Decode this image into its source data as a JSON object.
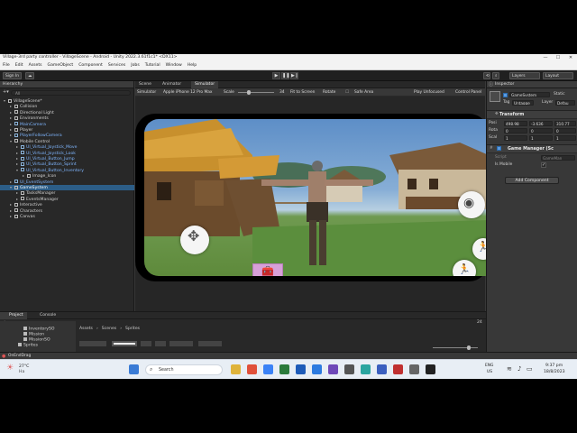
{
  "window": {
    "title": "Village-3rd party controller - VillageScene - Android - Unity 2022.3.61f1c1* <DX11>",
    "controls": [
      "—",
      "☐",
      "✕"
    ]
  },
  "menu": [
    "File",
    "Edit",
    "Assets",
    "GameObject",
    "Component",
    "Services",
    "Jobs",
    "Tutorial",
    "Window",
    "Help"
  ],
  "toolbar": {
    "signin": "Sign In",
    "layers": "Layers",
    "layout": "Layout"
  },
  "hierarchy": {
    "title": "Hierarchy",
    "search_placeholder": "All",
    "rows": [
      {
        "label": "VillageScene*",
        "depth": 0,
        "kind": "scene"
      },
      {
        "label": "Collision",
        "depth": 1
      },
      {
        "label": "Directional Light",
        "depth": 1
      },
      {
        "label": "Environments",
        "depth": 1
      },
      {
        "label": "MainCamera",
        "depth": 1,
        "blue": true
      },
      {
        "label": "Player",
        "depth": 1
      },
      {
        "label": "PlayerFollowCamera",
        "depth": 1,
        "blue": true
      },
      {
        "label": "Mobile Control",
        "depth": 1
      },
      {
        "label": "UI_Virtual_Joystick_Move",
        "depth": 2,
        "blue": true
      },
      {
        "label": "UI_Virtual_Joystick_Look",
        "depth": 2,
        "blue": true
      },
      {
        "label": "UI_Virtual_Button_Jump",
        "depth": 2,
        "blue": true
      },
      {
        "label": "UI_Virtual_Button_Sprint",
        "depth": 2,
        "blue": true
      },
      {
        "label": "UI_Virtual_Button_Inventory",
        "depth": 2,
        "blue": true
      },
      {
        "label": "Image_Icon",
        "depth": 3
      },
      {
        "label": "UI_EventSystem",
        "depth": 1,
        "blue": true
      },
      {
        "label": "GameSystem",
        "depth": 1,
        "selected": true
      },
      {
        "label": "TasksManager",
        "depth": 2
      },
      {
        "label": "EventsManager",
        "depth": 2
      },
      {
        "label": "Interactive",
        "depth": 1
      },
      {
        "label": "Characters",
        "depth": 1
      },
      {
        "label": "Canvas",
        "depth": 1
      }
    ]
  },
  "scene_tabs": [
    "Scene",
    "Animator",
    "Simulator"
  ],
  "scene_bar": {
    "mode": "Simulator",
    "device": "Apple iPhone 12 Pro Max",
    "scale_label": "Scale",
    "scale_value": "34",
    "fit": "Fit to Screen",
    "rotate": "Rotate",
    "safe_area": "Safe Area",
    "play_focus": "Play Unfocused",
    "control_panel": "Control Panel"
  },
  "inspector": {
    "title": "Inspector",
    "object_name": "GameSystem",
    "static_label": "Static",
    "tag_label": "Tag",
    "tag_value": "Untagge",
    "layer_label": "Layer",
    "layer_value": "Defau",
    "transform_title": "Transform",
    "pos_label": "Posi",
    "rot_label": "Rota",
    "scale_label": "Scal",
    "pos": [
      "498.98",
      "-3.636",
      "310.77"
    ],
    "rot": [
      "0",
      "0",
      "0"
    ],
    "scale": [
      "1",
      "1",
      "1"
    ],
    "component_title": "Game Manager (Sc",
    "script_label": "Script",
    "script_value": "GameMan",
    "is_mobile_label": "Is Mobile",
    "is_mobile": true,
    "add_component": "Add Component"
  },
  "project": {
    "tabs": [
      "Project",
      "Console"
    ],
    "folders": [
      "InventorySO",
      "Mission",
      "MissionSO",
      "Sprites"
    ],
    "breadcrumb": [
      "Assets",
      "Scenes",
      "Sprites"
    ],
    "count": "24"
  },
  "status": "OnEndDrag",
  "taskbar": {
    "weather_temp": "27°C",
    "weather_desc": "Ha",
    "search": "Search",
    "lang": "ENG",
    "region": "US",
    "time": "9:37 pm",
    "date": "18/8/2023"
  },
  "colors": {
    "selection": "#2c5d87",
    "prefab_blue": "#7fb6ff",
    "panel": "#383838"
  }
}
